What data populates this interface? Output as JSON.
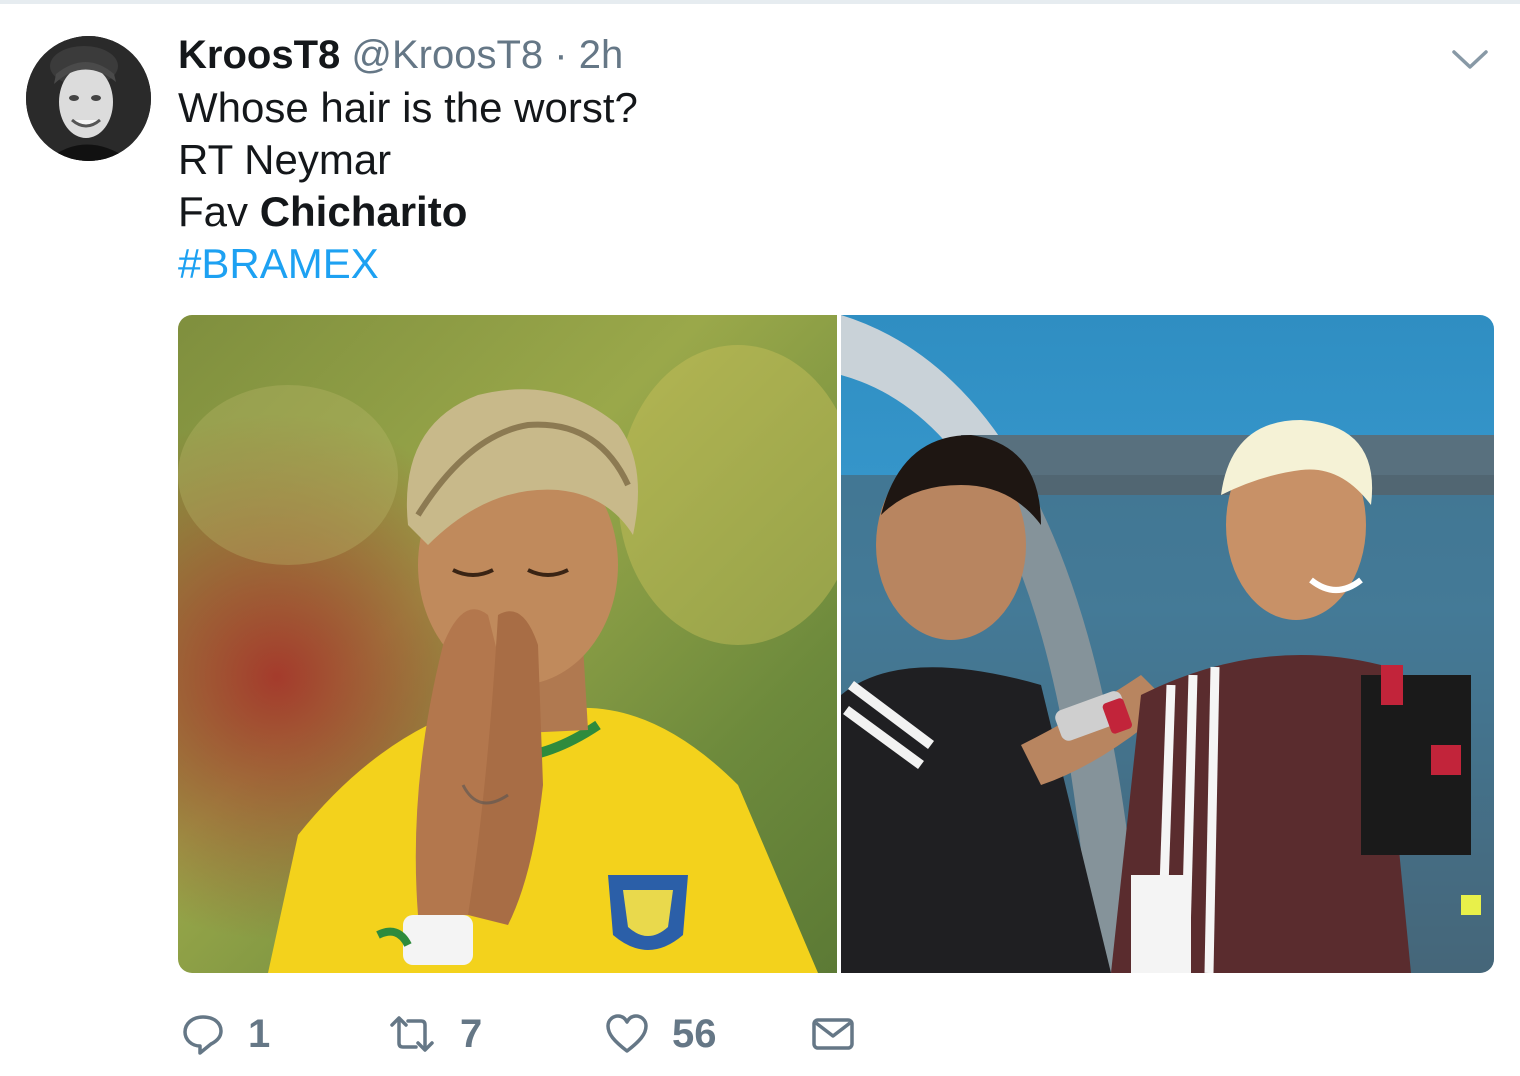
{
  "tweet": {
    "display_name": "KroosT8",
    "handle": "@KroosT8",
    "separator": "·",
    "time": "2h",
    "lines": {
      "question": "Whose hair is the worst?",
      "rt_option": "RT Neymar",
      "fav_prefix": "Fav ",
      "fav_name": "Chicharito",
      "hashtag": "#BRAMEX"
    },
    "images": [
      {
        "icon": "photo-player-yellow-jersey"
      },
      {
        "icon": "photo-player-and-staff"
      }
    ]
  },
  "actions": {
    "reply_icon": "reply-icon",
    "reply_count": "1",
    "retweet_icon": "retweet-icon",
    "retweet_count": "7",
    "like_icon": "heart-icon",
    "like_count": "56",
    "dm_icon": "envelope-icon"
  },
  "colors": {
    "link": "#1da1f2",
    "muted": "#657786",
    "text": "#14171a"
  }
}
